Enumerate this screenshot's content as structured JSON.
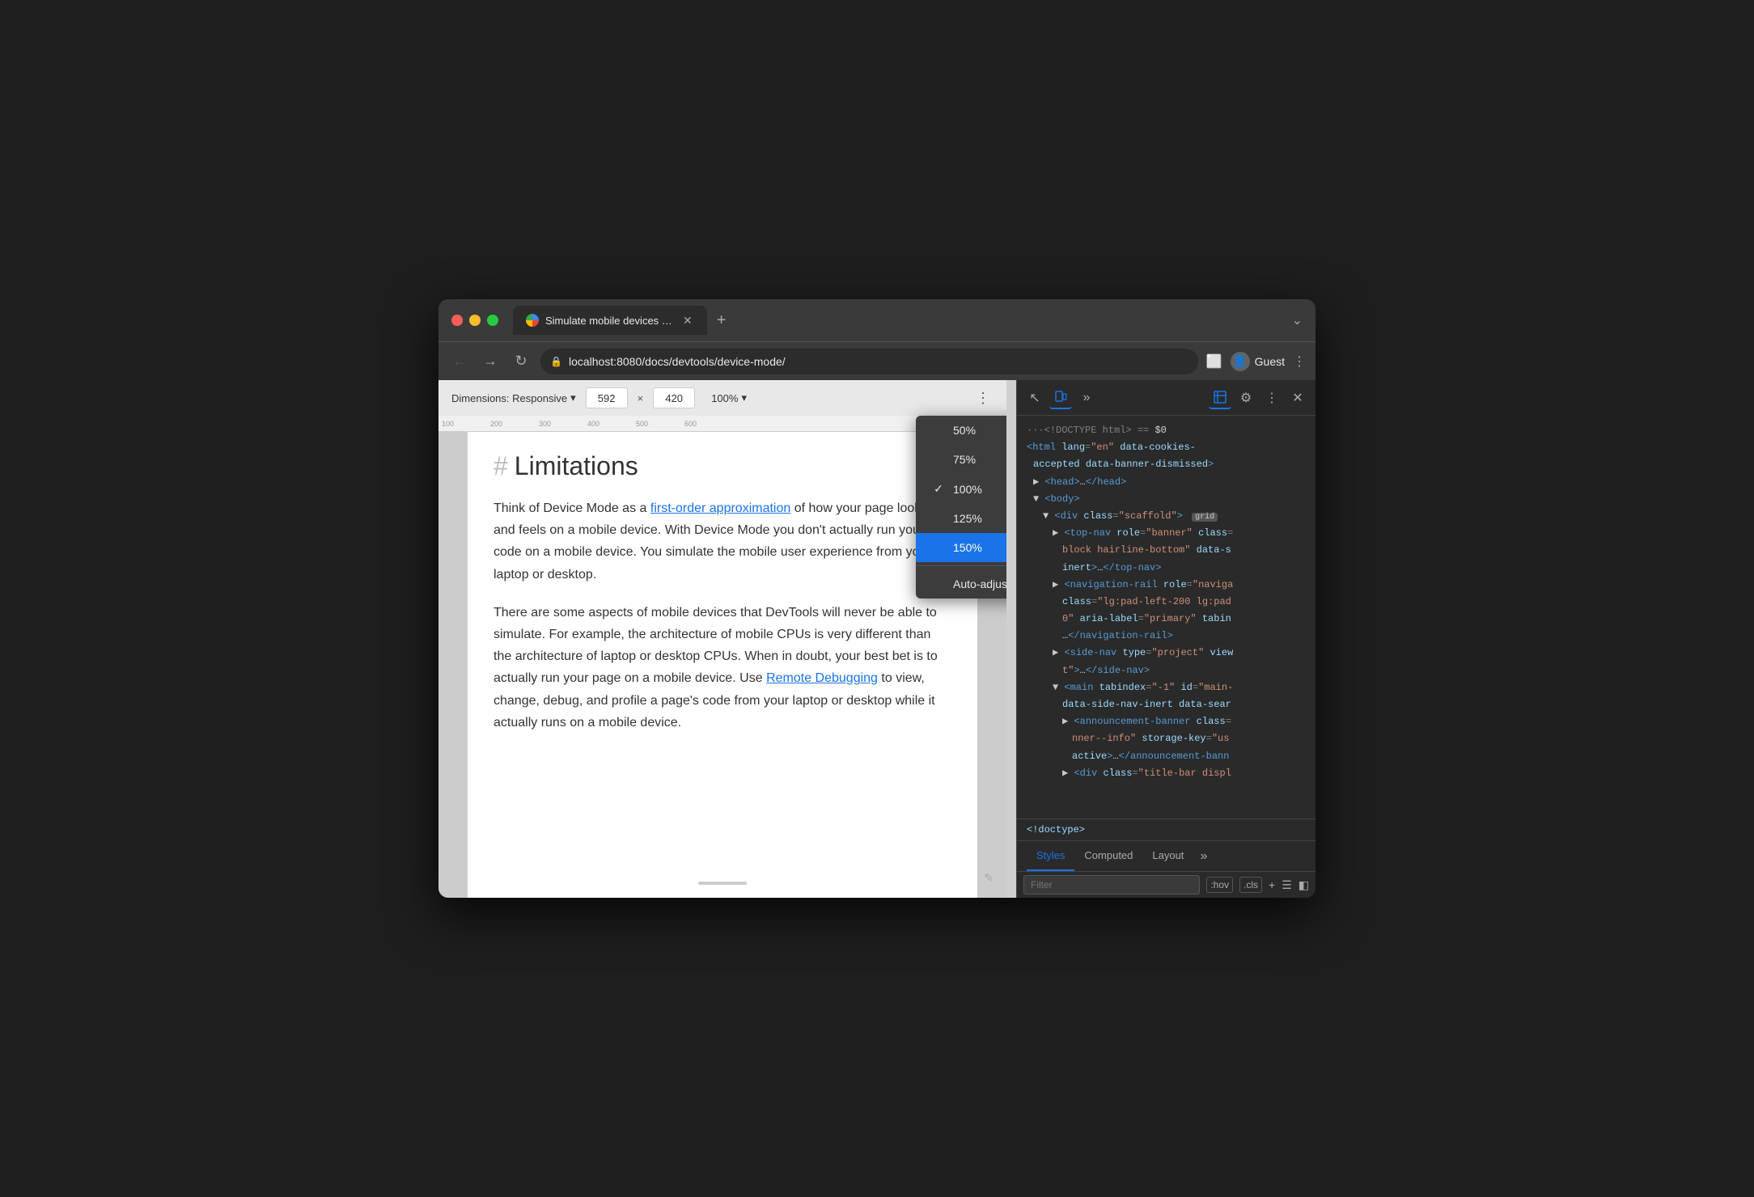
{
  "window": {
    "title": "Simulate mobile devices with D",
    "tab_title": "Simulate mobile devices with D"
  },
  "browser": {
    "back_label": "←",
    "forward_label": "→",
    "refresh_label": "↻",
    "url": "localhost:8080/docs/devtools/device-mode/",
    "guest_label": "Guest",
    "new_tab_label": "+",
    "menu_label": "⌄"
  },
  "device_toolbar": {
    "dimensions_label": "Dimensions: Responsive",
    "dropdown_arrow": "▾",
    "width_value": "592",
    "height_value": "420",
    "dim_separator": "×",
    "zoom_value": "100%",
    "zoom_arrow": "▾",
    "menu_dots": "⋮"
  },
  "zoom_dropdown": {
    "options": [
      {
        "label": "50%",
        "selected": false,
        "checked": false
      },
      {
        "label": "75%",
        "selected": false,
        "checked": false
      },
      {
        "label": "100%",
        "selected": false,
        "checked": true
      },
      {
        "label": "125%",
        "selected": false,
        "checked": false
      },
      {
        "label": "150%",
        "selected": true,
        "checked": false
      }
    ],
    "auto_adjust_label": "Auto-adjust zoom"
  },
  "page_content": {
    "heading": "Limitations",
    "hash": "#",
    "paragraph1": "Think of Device Mode as a ",
    "link1": "first-order approximation",
    "paragraph1_cont": " of how your page looks and feels on a mobile device. With Device Mode you don't actually run your code on a mobile device. You simulate the mobile user experience from your laptop or desktop.",
    "paragraph2": "There are some aspects of mobile devices that DevTools will never be able to simulate. For example, the architecture of mobile CPUs is very different than the architecture of laptop or desktop CPUs. When in doubt, your best bet is to actually run your page on a mobile device. Use ",
    "link2": "Remote Debugging",
    "paragraph2_cont": " to view, change, debug, and profile a page's code from your laptop or desktop while it actually runs on a mobile device."
  },
  "devtools": {
    "icons": {
      "pointer": "↖",
      "device": "📱",
      "more": "»",
      "console": "≡",
      "settings": "⚙",
      "dots": "⋮",
      "close": "✕"
    },
    "html_lines": [
      {
        "indent": 0,
        "content": "···<!DOCTYPE html> == $0",
        "type": "comment"
      },
      {
        "indent": 0,
        "content": "<html lang=\"en\" data-cookies-accepted data-banner-dismissed>",
        "type": "tag"
      },
      {
        "indent": 1,
        "content": "▶ <head>…</head>",
        "type": "collapsed"
      },
      {
        "indent": 1,
        "content": "▼ <body>",
        "type": "open"
      },
      {
        "indent": 2,
        "content": "▼ <div class=\"scaffold\">",
        "type": "open",
        "badge": "grid"
      },
      {
        "indent": 3,
        "content": "▶ <top-nav role=\"banner\" class=",
        "type": "partial"
      },
      {
        "indent": 4,
        "content": "block hairline-bottom\" data-s",
        "type": "partial"
      },
      {
        "indent": 4,
        "content": "inert>…</top-nav>",
        "type": "partial"
      },
      {
        "indent": 3,
        "content": "▶ <navigation-rail role=\"naviga",
        "type": "partial"
      },
      {
        "indent": 4,
        "content": "class=\"lg:pad-left-200 lg:pad",
        "type": "partial"
      },
      {
        "indent": 4,
        "content": "0\" aria-label=\"primary\" tabin",
        "type": "partial"
      },
      {
        "indent": 4,
        "content": "…</navigation-rail>",
        "type": "partial"
      },
      {
        "indent": 3,
        "content": "▶ <side-nav type=\"project\" view",
        "type": "partial"
      },
      {
        "indent": 4,
        "content": "t\">…</side-nav>",
        "type": "partial"
      },
      {
        "indent": 3,
        "content": "▼ <main tabindex=\"-1\" id=\"main-",
        "type": "partial"
      },
      {
        "indent": 4,
        "content": "data-side-nav-inert data-sear",
        "type": "partial"
      },
      {
        "indent": 4,
        "content": "▶ <announcement-banner class=",
        "type": "partial"
      },
      {
        "indent": 5,
        "content": "nner--info\" storage-key=\"us",
        "type": "partial"
      },
      {
        "indent": 5,
        "content": "active>…</announcement-bann",
        "type": "partial"
      },
      {
        "indent": 4,
        "content": "▶ <div class=\"title-bar displ",
        "type": "partial"
      }
    ],
    "doctype": "<!doctype>",
    "tabs": {
      "styles_label": "Styles",
      "computed_label": "Computed",
      "layout_label": "Layout",
      "more_label": "»"
    },
    "filter": {
      "placeholder": "Filter",
      "hov_label": ":hov",
      "cls_label": ".cls",
      "plus_label": "+"
    }
  }
}
